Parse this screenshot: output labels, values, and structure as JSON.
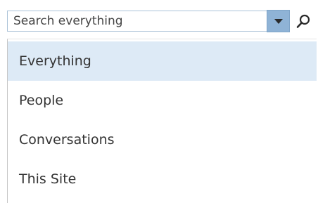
{
  "search": {
    "placeholder": "Search everything",
    "value": ""
  },
  "scope_dropdown": {
    "icon": "chevron-down-icon",
    "color": "#8fb3d6"
  },
  "search_button": {
    "icon": "search-icon"
  },
  "menu": {
    "selected": "Everything",
    "selected_color": "#ddeaf6",
    "items": [
      {
        "label": "Everything"
      },
      {
        "label": "People"
      },
      {
        "label": "Conversations"
      },
      {
        "label": "This Site"
      }
    ]
  }
}
